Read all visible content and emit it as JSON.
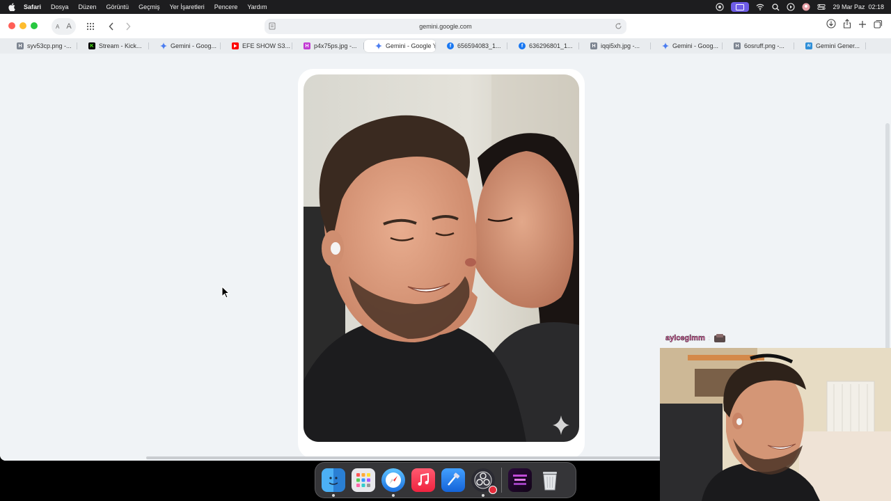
{
  "menubar": {
    "app_name": "Safari",
    "items": [
      "Dosya",
      "Düzen",
      "Görüntü",
      "Geçmiş",
      "Yer İşaretleri",
      "Pencere",
      "Yardım"
    ],
    "datetime": "29 Mar Paz  02:18"
  },
  "toolbar": {
    "text_small": "A",
    "text_large": "A",
    "url": "gemini.google.com"
  },
  "tabs": [
    {
      "label": "syv53cp.png -...",
      "icon": "h-letter-icon",
      "color": "#7d8591"
    },
    {
      "label": "Stream - Kick...",
      "icon": "kick-icon",
      "color": "#53fc18"
    },
    {
      "label": "Gemini - Goog...",
      "icon": "gemini-sparkle-icon",
      "color": "#4a7cf0"
    },
    {
      "label": "EFE SHOW S3...",
      "icon": "youtube-icon",
      "color": "#ff0000"
    },
    {
      "label": "p4x75ps.jpg -...",
      "icon": "h-letter-icon",
      "color": "#c23bd4"
    },
    {
      "label": "Gemini - Google Yap...",
      "icon": "gemini-sparkle-icon",
      "color": "#4a7cf0",
      "active": true
    },
    {
      "label": "656594083_1...",
      "icon": "facebook-icon",
      "color": "#1877f2"
    },
    {
      "label": "636296801_1...",
      "icon": "facebook-icon",
      "color": "#1877f2"
    },
    {
      "label": "iqqi5xh.jpg -...",
      "icon": "h-letter-icon",
      "color": "#7d8591"
    },
    {
      "label": "Gemini - Goog...",
      "icon": "gemini-sparkle-icon",
      "color": "#4a7cf0"
    },
    {
      "label": "6osruff.png -...",
      "icon": "h-letter-icon",
      "color": "#7d8591"
    },
    {
      "label": "Gemini Gener...",
      "icon": "generator-icon",
      "color": "#2f8fd8"
    }
  ],
  "dock": {
    "apps": [
      "finder-icon",
      "launchpad-icon",
      "safari-icon",
      "music-icon",
      "xcode-icon",
      "obs-icon",
      "stream-art-icon",
      "trash-icon"
    ]
  },
  "overlay": {
    "chat_user": "aylcegimm"
  },
  "colors": {
    "accent": "#6e5ce6",
    "page_bg": "#f0f3f6",
    "close": "#ff5f57",
    "minimize": "#febc2e",
    "zoom": "#28c840"
  }
}
